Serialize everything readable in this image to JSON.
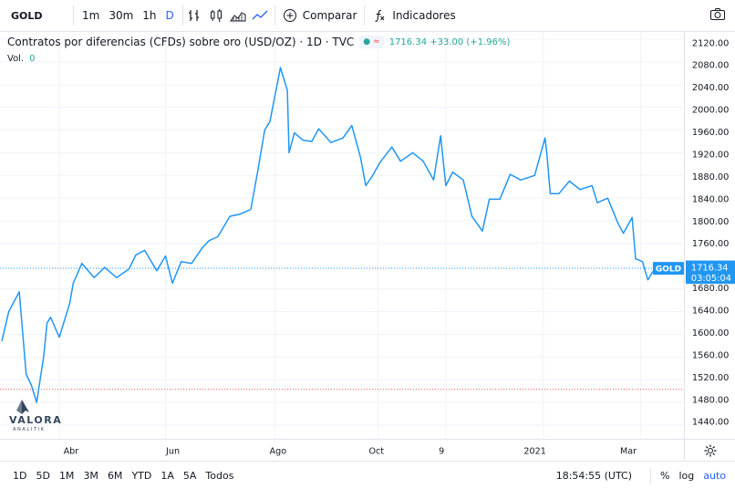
{
  "toolbar": {
    "symbol": "GOLD",
    "timeframes": [
      "1m",
      "30m",
      "1h",
      "D"
    ],
    "compare_label": "Comparar",
    "indicators_label": "Indicadores"
  },
  "legend": {
    "title": "Contratos por diferencias (CFDs) sobre oro (USD/OZ) · 1D · TVC",
    "quote": "1716.34 +33.00 (+1.96%)",
    "vol_label": "Vol.",
    "vol_value": "0"
  },
  "price_tag": {
    "label": "GOLD",
    "price": "1716.34",
    "countdown": "03:05:04"
  },
  "bottombar": {
    "ranges": [
      "1D",
      "5D",
      "1M",
      "3M",
      "6M",
      "YTD",
      "1A",
      "5A",
      "Todos"
    ],
    "time": "18:54:55 (UTC)",
    "pct": "%",
    "log": "log",
    "auto": "auto"
  },
  "logo": {
    "name": "VALORA",
    "tag": "ANALITIK"
  },
  "colors": {
    "line": "#2196f3",
    "grid": "#f0f3fa",
    "up": "#26a69a",
    "low_line": "#ef5350"
  },
  "chart_data": {
    "type": "line",
    "title": "Contratos por diferencias (CFDs) sobre oro (USD/OZ) · 1D · TVC",
    "xlabel": "",
    "ylabel": "",
    "ylim": [
      1420,
      2140
    ],
    "yticks": [
      1440,
      1480,
      1520,
      1560,
      1600,
      1640,
      1680,
      1720,
      1760,
      1800,
      1840,
      1880,
      1920,
      1960,
      2000,
      2040,
      2080,
      2120
    ],
    "xticks": [
      {
        "label": "Abr",
        "x": "2020-04-01"
      },
      {
        "label": "Jun",
        "x": "2020-06-01"
      },
      {
        "label": "Ago",
        "x": "2020-08-03"
      },
      {
        "label": "Oct",
        "x": "2020-10-01"
      },
      {
        "label": "9",
        "x": "2020-11-09"
      },
      {
        "label": "2021",
        "x": "2021-01-04"
      },
      {
        "label": "Mar",
        "x": "2021-03-01"
      }
    ],
    "last_price": 1716.34,
    "low_reference": 1503,
    "grid": true,
    "series": [
      {
        "name": "GOLD",
        "x": [
          "2020-02-28",
          "2020-03-03",
          "2020-03-09",
          "2020-03-13",
          "2020-03-16",
          "2020-03-19",
          "2020-03-23",
          "2020-03-25",
          "2020-03-27",
          "2020-04-01",
          "2020-04-07",
          "2020-04-09",
          "2020-04-14",
          "2020-04-21",
          "2020-04-27",
          "2020-05-04",
          "2020-05-11",
          "2020-05-15",
          "2020-05-20",
          "2020-05-27",
          "2020-06-01",
          "2020-06-05",
          "2020-06-10",
          "2020-06-16",
          "2020-06-22",
          "2020-06-26",
          "2020-07-01",
          "2020-07-08",
          "2020-07-14",
          "2020-07-20",
          "2020-07-24",
          "2020-07-28",
          "2020-07-31",
          "2020-08-06",
          "2020-08-10",
          "2020-08-11",
          "2020-08-14",
          "2020-08-19",
          "2020-08-24",
          "2020-08-28",
          "2020-09-04",
          "2020-09-11",
          "2020-09-16",
          "2020-09-21",
          "2020-09-24",
          "2020-09-28",
          "2020-10-02",
          "2020-10-09",
          "2020-10-14",
          "2020-10-21",
          "2020-10-27",
          "2020-11-02",
          "2020-11-06",
          "2020-11-09",
          "2020-11-13",
          "2020-11-19",
          "2020-11-24",
          "2020-11-30",
          "2020-12-04",
          "2020-12-10",
          "2020-12-16",
          "2020-12-22",
          "2020-12-30",
          "2021-01-05",
          "2021-01-06",
          "2021-01-08",
          "2021-01-13",
          "2021-01-19",
          "2021-01-25",
          "2021-02-01",
          "2021-02-04",
          "2021-02-10",
          "2021-02-16",
          "2021-02-19",
          "2021-02-24",
          "2021-02-26",
          "2021-03-02",
          "2021-03-05",
          "2021-03-09"
        ],
        "y": [
          1588,
          1640,
          1675,
          1530,
          1510,
          1480,
          1560,
          1620,
          1630,
          1595,
          1655,
          1690,
          1725,
          1700,
          1718,
          1700,
          1715,
          1740,
          1748,
          1712,
          1738,
          1690,
          1728,
          1725,
          1752,
          1765,
          1772,
          1808,
          1812,
          1820,
          1888,
          1960,
          1975,
          2070,
          2030,
          1920,
          1955,
          1942,
          1940,
          1962,
          1938,
          1946,
          1968,
          1912,
          1862,
          1880,
          1902,
          1930,
          1905,
          1920,
          1905,
          1872,
          1950,
          1862,
          1886,
          1872,
          1808,
          1782,
          1838,
          1838,
          1882,
          1872,
          1880,
          1946,
          1920,
          1848,
          1848,
          1870,
          1855,
          1862,
          1832,
          1840,
          1795,
          1778,
          1806,
          1733,
          1728,
          1696,
          1716
        ]
      }
    ]
  }
}
